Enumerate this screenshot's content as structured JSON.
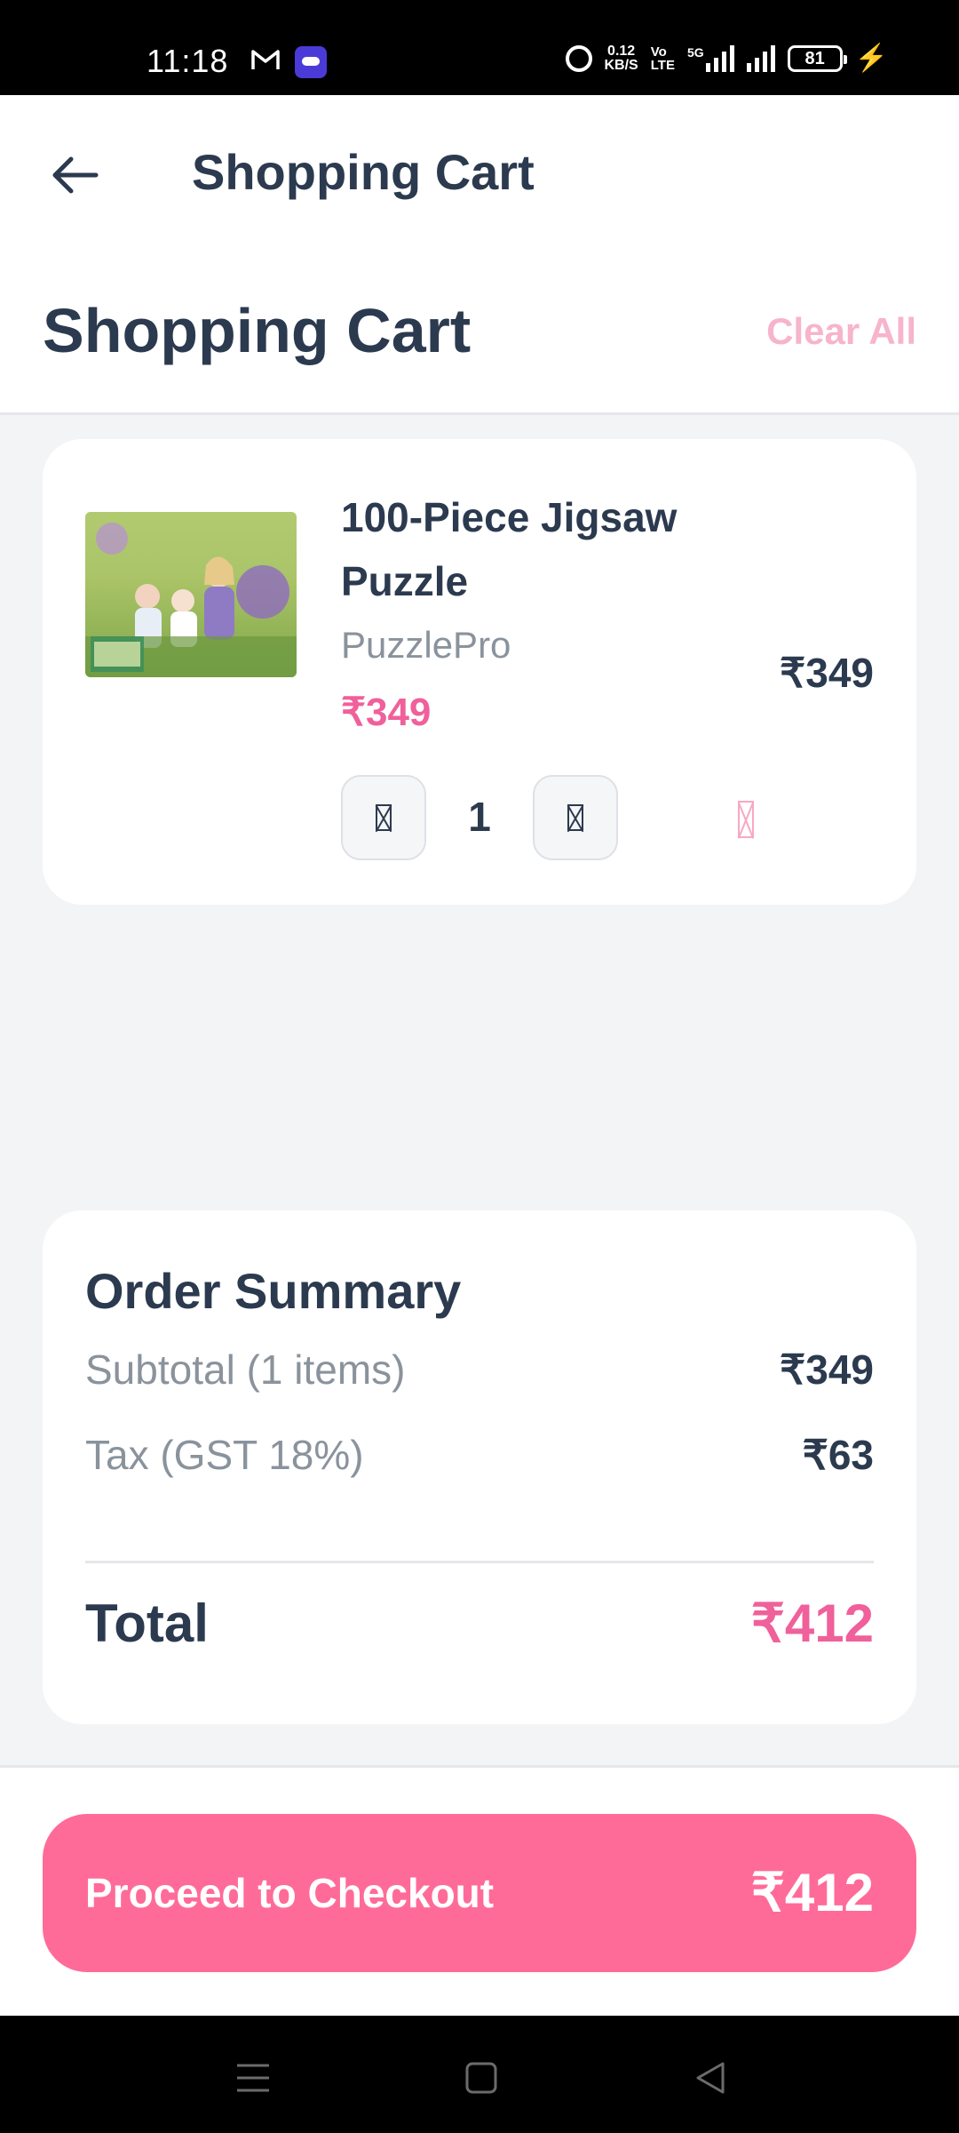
{
  "status_bar": {
    "time": "11:18",
    "speed_value": "0.12",
    "speed_unit": "KB/S",
    "volte_top": "Vo",
    "volte_bottom": "LTE",
    "network": "5G",
    "battery": "81"
  },
  "app_bar": {
    "title": "Shopping Cart",
    "back_icon": "arrow-left-icon"
  },
  "page_header": {
    "title": "Shopping Cart",
    "clear_all_label": "Clear All"
  },
  "cart": {
    "items": [
      {
        "name": "100-Piece Jigsaw Puzzle",
        "brand": "PuzzlePro",
        "price": "₹349",
        "line_total": "₹349",
        "quantity": "1"
      }
    ]
  },
  "summary": {
    "title": "Order Summary",
    "subtotal_label": "Subtotal (1 items)",
    "subtotal_value": "₹349",
    "tax_label": "Tax (GST 18%)",
    "tax_value": "₹63",
    "total_label": "Total",
    "total_value": "₹412"
  },
  "checkout": {
    "label": "Proceed to Checkout",
    "amount": "₹412"
  },
  "colors": {
    "accent": "#ff6b98",
    "price_pink": "#f0609a",
    "text_dark": "#2c3a4f",
    "text_muted": "#8a939c"
  }
}
